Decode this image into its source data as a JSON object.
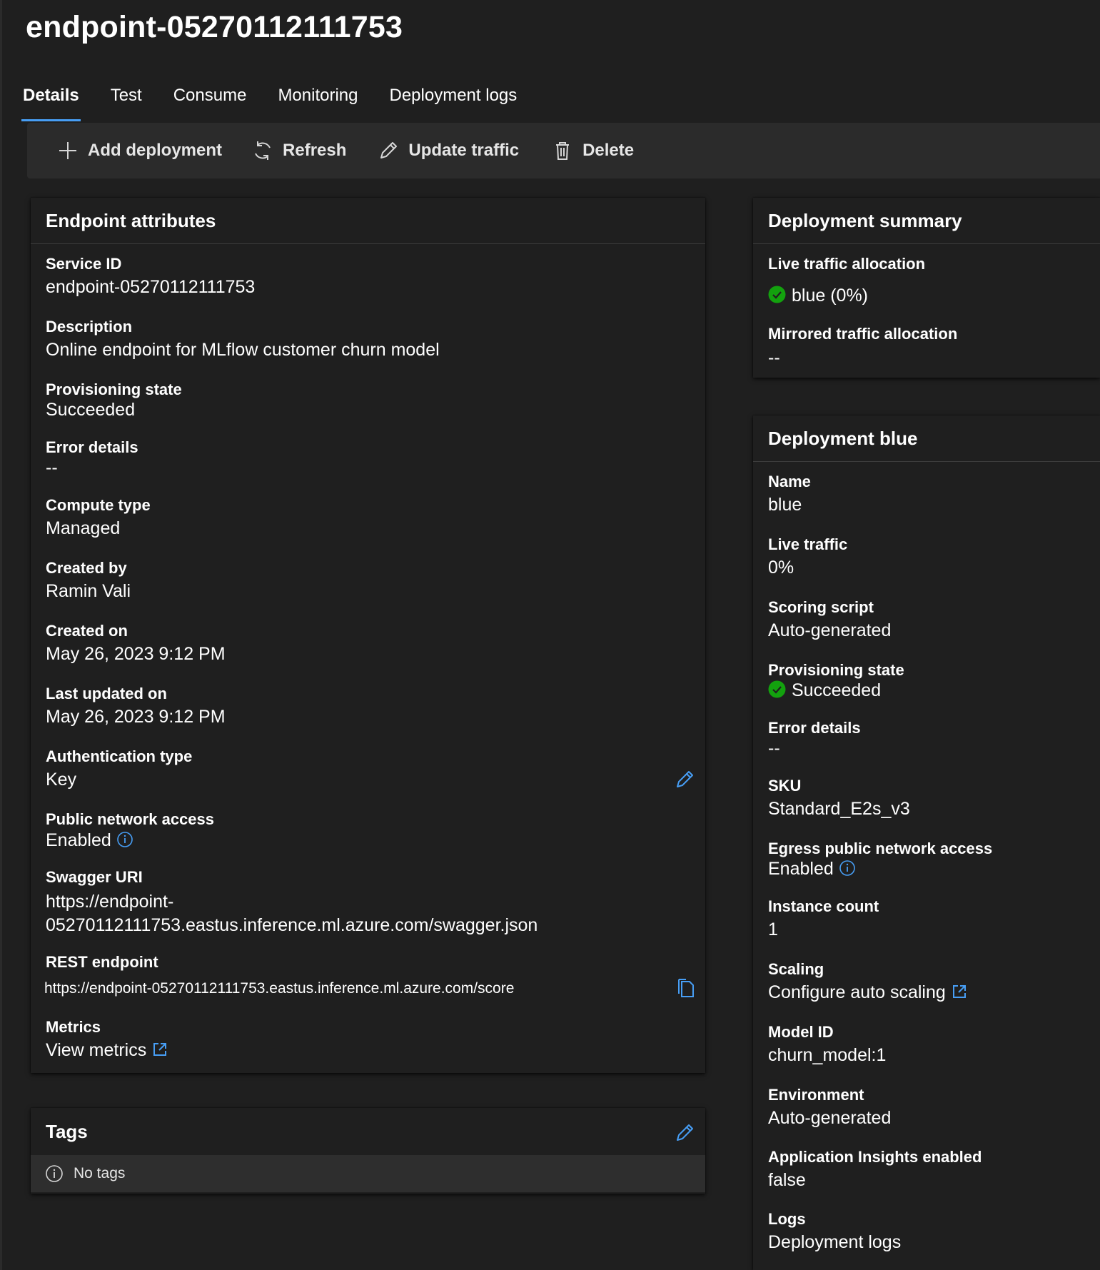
{
  "header": {
    "title": "endpoint-05270112111753"
  },
  "tabs": [
    {
      "label": "Details",
      "active": true
    },
    {
      "label": "Test"
    },
    {
      "label": "Consume"
    },
    {
      "label": "Monitoring"
    },
    {
      "label": "Deployment logs"
    }
  ],
  "toolbar": {
    "add_label": "Add deployment",
    "refresh_label": "Refresh",
    "update_label": "Update traffic",
    "delete_label": "Delete"
  },
  "endpoint_attributes": {
    "title": "Endpoint attributes",
    "fields": [
      {
        "label": "Service ID",
        "value": "endpoint-05270112111753"
      },
      {
        "label": "Description",
        "value": "Online endpoint for MLflow customer churn model"
      },
      {
        "label": "Provisioning state",
        "value": "Succeeded"
      },
      {
        "label": "Error details",
        "value": "--"
      },
      {
        "label": "Compute type",
        "value": "Managed"
      },
      {
        "label": "Created by",
        "value": "Ramin Vali"
      },
      {
        "label": "Created on",
        "value": "May 26, 2023 9:12 PM"
      },
      {
        "label": "Last updated on",
        "value": "May 26, 2023 9:12 PM"
      },
      {
        "label": "Authentication type",
        "value": "Key"
      },
      {
        "label": "Public network access",
        "value": "Enabled"
      },
      {
        "label": "Swagger URI",
        "value_line1": "https://endpoint-",
        "value_line2": "05270112111753.eastus.inference.ml.azure.com/swagger.json"
      },
      {
        "label": "REST endpoint",
        "value": "https://endpoint-05270112111753.eastus.inference.ml.azure.com/score"
      },
      {
        "label": "Metrics",
        "value": "View metrics"
      }
    ]
  },
  "tags": {
    "title": "Tags",
    "empty_text": "No tags"
  },
  "deployment_summary": {
    "title": "Deployment summary",
    "live_label": "Live traffic allocation",
    "live_value": "blue (0%)",
    "mirrored_label": "Mirrored traffic allocation",
    "mirrored_value": "--"
  },
  "deployment_blue": {
    "title": "Deployment blue",
    "fields": [
      {
        "label": "Name",
        "value": "blue"
      },
      {
        "label": "Live traffic",
        "value": "0%"
      },
      {
        "label": "Scoring script",
        "value": "Auto-generated"
      },
      {
        "label": "Provisioning state",
        "value": "Succeeded"
      },
      {
        "label": "Error details",
        "value": "--"
      },
      {
        "label": "SKU",
        "value": "Standard_E2s_v3"
      },
      {
        "label": "Egress public network access",
        "value": "Enabled"
      },
      {
        "label": "Instance count",
        "value": "1"
      },
      {
        "label": "Scaling",
        "value": "Configure auto scaling"
      },
      {
        "label": "Model ID",
        "value": "churn_model:1"
      },
      {
        "label": "Environment",
        "value": "Auto-generated"
      },
      {
        "label": "Application Insights enabled",
        "value": "false"
      },
      {
        "label": "Logs",
        "value": "Deployment logs"
      }
    ]
  },
  "colors": {
    "background": "#1f1f1f",
    "accent": "#479ef5",
    "success": "#13a10e",
    "toolbar": "#2b2b2b"
  }
}
